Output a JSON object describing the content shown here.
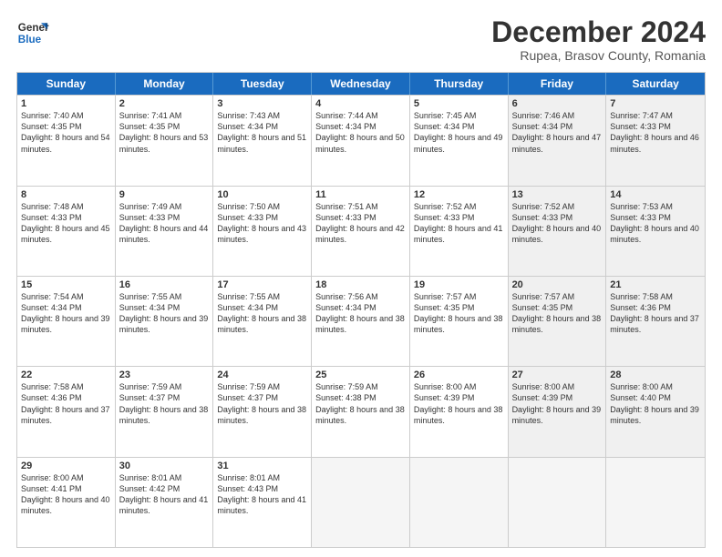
{
  "header": {
    "logo_line1": "General",
    "logo_line2": "Blue",
    "month": "December 2024",
    "location": "Rupea, Brasov County, Romania"
  },
  "days_of_week": [
    "Sunday",
    "Monday",
    "Tuesday",
    "Wednesday",
    "Thursday",
    "Friday",
    "Saturday"
  ],
  "weeks": [
    [
      {
        "day": "1",
        "rise": "Sunrise: 7:40 AM",
        "set": "Sunset: 4:35 PM",
        "day_text": "Daylight: 8 hours and 54 minutes.",
        "shaded": false
      },
      {
        "day": "2",
        "rise": "Sunrise: 7:41 AM",
        "set": "Sunset: 4:35 PM",
        "day_text": "Daylight: 8 hours and 53 minutes.",
        "shaded": false
      },
      {
        "day": "3",
        "rise": "Sunrise: 7:43 AM",
        "set": "Sunset: 4:34 PM",
        "day_text": "Daylight: 8 hours and 51 minutes.",
        "shaded": false
      },
      {
        "day": "4",
        "rise": "Sunrise: 7:44 AM",
        "set": "Sunset: 4:34 PM",
        "day_text": "Daylight: 8 hours and 50 minutes.",
        "shaded": false
      },
      {
        "day": "5",
        "rise": "Sunrise: 7:45 AM",
        "set": "Sunset: 4:34 PM",
        "day_text": "Daylight: 8 hours and 49 minutes.",
        "shaded": false
      },
      {
        "day": "6",
        "rise": "Sunrise: 7:46 AM",
        "set": "Sunset: 4:34 PM",
        "day_text": "Daylight: 8 hours and 47 minutes.",
        "shaded": true
      },
      {
        "day": "7",
        "rise": "Sunrise: 7:47 AM",
        "set": "Sunset: 4:33 PM",
        "day_text": "Daylight: 8 hours and 46 minutes.",
        "shaded": true
      }
    ],
    [
      {
        "day": "8",
        "rise": "Sunrise: 7:48 AM",
        "set": "Sunset: 4:33 PM",
        "day_text": "Daylight: 8 hours and 45 minutes.",
        "shaded": false
      },
      {
        "day": "9",
        "rise": "Sunrise: 7:49 AM",
        "set": "Sunset: 4:33 PM",
        "day_text": "Daylight: 8 hours and 44 minutes.",
        "shaded": false
      },
      {
        "day": "10",
        "rise": "Sunrise: 7:50 AM",
        "set": "Sunset: 4:33 PM",
        "day_text": "Daylight: 8 hours and 43 minutes.",
        "shaded": false
      },
      {
        "day": "11",
        "rise": "Sunrise: 7:51 AM",
        "set": "Sunset: 4:33 PM",
        "day_text": "Daylight: 8 hours and 42 minutes.",
        "shaded": false
      },
      {
        "day": "12",
        "rise": "Sunrise: 7:52 AM",
        "set": "Sunset: 4:33 PM",
        "day_text": "Daylight: 8 hours and 41 minutes.",
        "shaded": false
      },
      {
        "day": "13",
        "rise": "Sunrise: 7:52 AM",
        "set": "Sunset: 4:33 PM",
        "day_text": "Daylight: 8 hours and 40 minutes.",
        "shaded": true
      },
      {
        "day": "14",
        "rise": "Sunrise: 7:53 AM",
        "set": "Sunset: 4:33 PM",
        "day_text": "Daylight: 8 hours and 40 minutes.",
        "shaded": true
      }
    ],
    [
      {
        "day": "15",
        "rise": "Sunrise: 7:54 AM",
        "set": "Sunset: 4:34 PM",
        "day_text": "Daylight: 8 hours and 39 minutes.",
        "shaded": false
      },
      {
        "day": "16",
        "rise": "Sunrise: 7:55 AM",
        "set": "Sunset: 4:34 PM",
        "day_text": "Daylight: 8 hours and 39 minutes.",
        "shaded": false
      },
      {
        "day": "17",
        "rise": "Sunrise: 7:55 AM",
        "set": "Sunset: 4:34 PM",
        "day_text": "Daylight: 8 hours and 38 minutes.",
        "shaded": false
      },
      {
        "day": "18",
        "rise": "Sunrise: 7:56 AM",
        "set": "Sunset: 4:34 PM",
        "day_text": "Daylight: 8 hours and 38 minutes.",
        "shaded": false
      },
      {
        "day": "19",
        "rise": "Sunrise: 7:57 AM",
        "set": "Sunset: 4:35 PM",
        "day_text": "Daylight: 8 hours and 38 minutes.",
        "shaded": false
      },
      {
        "day": "20",
        "rise": "Sunrise: 7:57 AM",
        "set": "Sunset: 4:35 PM",
        "day_text": "Daylight: 8 hours and 38 minutes.",
        "shaded": true
      },
      {
        "day": "21",
        "rise": "Sunrise: 7:58 AM",
        "set": "Sunset: 4:36 PM",
        "day_text": "Daylight: 8 hours and 37 minutes.",
        "shaded": true
      }
    ],
    [
      {
        "day": "22",
        "rise": "Sunrise: 7:58 AM",
        "set": "Sunset: 4:36 PM",
        "day_text": "Daylight: 8 hours and 37 minutes.",
        "shaded": false
      },
      {
        "day": "23",
        "rise": "Sunrise: 7:59 AM",
        "set": "Sunset: 4:37 PM",
        "day_text": "Daylight: 8 hours and 38 minutes.",
        "shaded": false
      },
      {
        "day": "24",
        "rise": "Sunrise: 7:59 AM",
        "set": "Sunset: 4:37 PM",
        "day_text": "Daylight: 8 hours and 38 minutes.",
        "shaded": false
      },
      {
        "day": "25",
        "rise": "Sunrise: 7:59 AM",
        "set": "Sunset: 4:38 PM",
        "day_text": "Daylight: 8 hours and 38 minutes.",
        "shaded": false
      },
      {
        "day": "26",
        "rise": "Sunrise: 8:00 AM",
        "set": "Sunset: 4:39 PM",
        "day_text": "Daylight: 8 hours and 38 minutes.",
        "shaded": false
      },
      {
        "day": "27",
        "rise": "Sunrise: 8:00 AM",
        "set": "Sunset: 4:39 PM",
        "day_text": "Daylight: 8 hours and 39 minutes.",
        "shaded": true
      },
      {
        "day": "28",
        "rise": "Sunrise: 8:00 AM",
        "set": "Sunset: 4:40 PM",
        "day_text": "Daylight: 8 hours and 39 minutes.",
        "shaded": true
      }
    ],
    [
      {
        "day": "29",
        "rise": "Sunrise: 8:00 AM",
        "set": "Sunset: 4:41 PM",
        "day_text": "Daylight: 8 hours and 40 minutes.",
        "shaded": false
      },
      {
        "day": "30",
        "rise": "Sunrise: 8:01 AM",
        "set": "Sunset: 4:42 PM",
        "day_text": "Daylight: 8 hours and 41 minutes.",
        "shaded": false
      },
      {
        "day": "31",
        "rise": "Sunrise: 8:01 AM",
        "set": "Sunset: 4:43 PM",
        "day_text": "Daylight: 8 hours and 41 minutes.",
        "shaded": false
      },
      {
        "day": "",
        "rise": "",
        "set": "",
        "day_text": "",
        "shaded": false,
        "empty": true
      },
      {
        "day": "",
        "rise": "",
        "set": "",
        "day_text": "",
        "shaded": false,
        "empty": true
      },
      {
        "day": "",
        "rise": "",
        "set": "",
        "day_text": "",
        "shaded": false,
        "empty": true
      },
      {
        "day": "",
        "rise": "",
        "set": "",
        "day_text": "",
        "shaded": false,
        "empty": true
      }
    ]
  ]
}
